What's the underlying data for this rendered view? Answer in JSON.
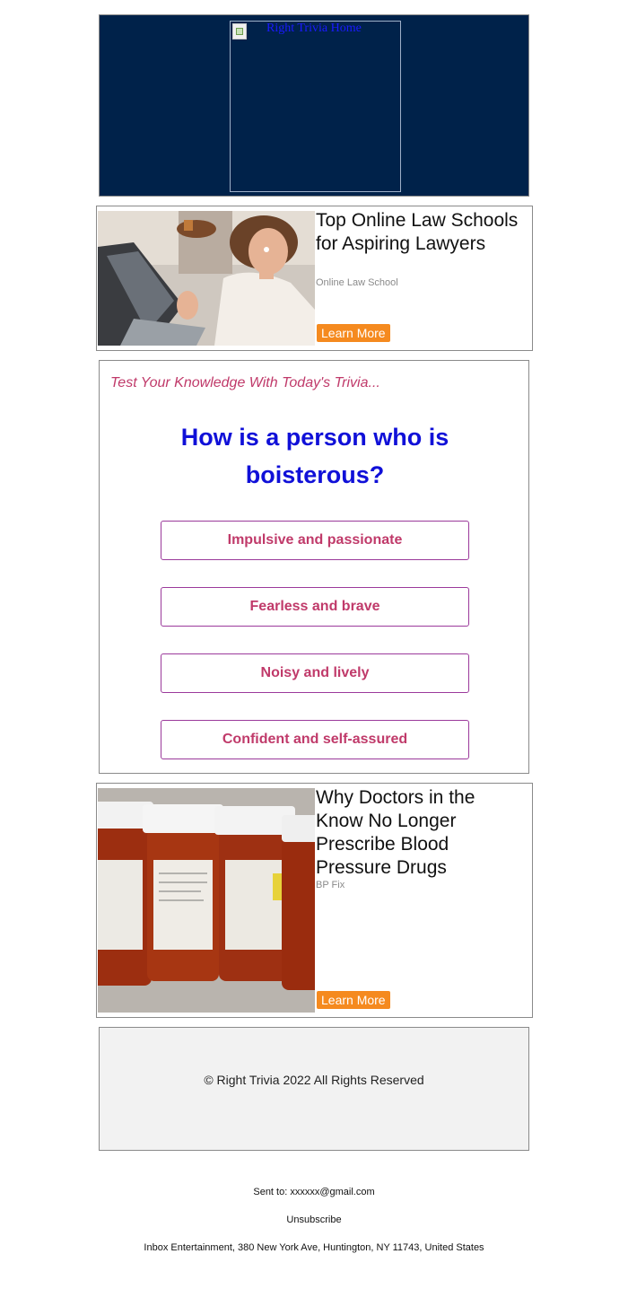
{
  "header": {
    "logo_alt": "Right Trivia Home",
    "background_color": "#00224a"
  },
  "ad1": {
    "title": "Top Online Law Schools for Aspiring Lawyers",
    "source": "Online Law School",
    "button_label": "Learn More"
  },
  "trivia": {
    "intro": "Test Your Knowledge With Today's Trivia...",
    "question": "How is a person who is boisterous?",
    "answers": [
      "Impulsive and passionate",
      "Fearless and brave",
      "Noisy and lively",
      "Confident and self-assured"
    ]
  },
  "ad2": {
    "title": "Why Doctors in the Know No Longer Prescribe Blood Pressure Drugs",
    "source": "BP Fix",
    "button_label": "Learn More"
  },
  "footer": {
    "copyright": "© Right Trivia 2022 All Rights Reserved",
    "sent_to": "Sent to: xxxxxx@gmail.com",
    "unsubscribe": "Unsubscribe",
    "address": "Inbox Entertainment, 380 New York Ave, Huntington, NY 11743, United States"
  },
  "colors": {
    "accent_button": "#f58a1f",
    "question_text": "#1010d8",
    "answer_text": "#c03a6a",
    "answer_border": "#9b3a9b"
  }
}
